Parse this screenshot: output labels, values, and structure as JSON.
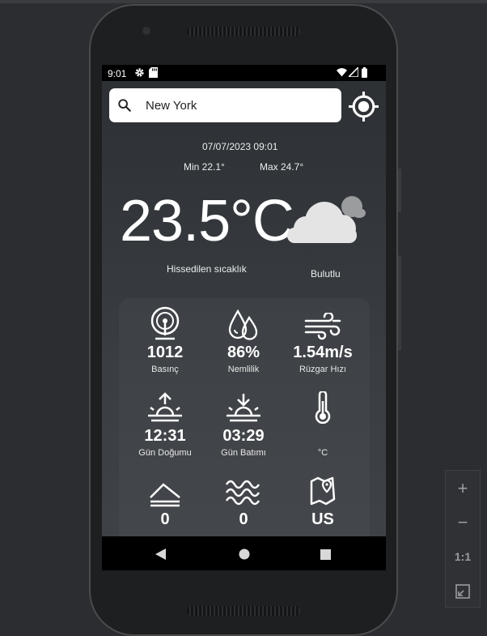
{
  "status": {
    "time": "9:01"
  },
  "search": {
    "value": "New York"
  },
  "weather": {
    "datetime": "07/07/2023 09:01",
    "min": "Min 22.1°",
    "max": "Max 24.7°",
    "temperature": "23.5°C",
    "feels_like_label": "Hissedilen sıcaklık",
    "condition": "Bulutlu"
  },
  "details": [
    {
      "icon": "pressure-gauge-icon",
      "value": "1012",
      "label": "Basınç"
    },
    {
      "icon": "humidity-drops-icon",
      "value": "86%",
      "label": "Nemlilik"
    },
    {
      "icon": "wind-icon",
      "value": "1.54m/s",
      "label": "Rüzgar Hızı"
    },
    {
      "icon": "sunrise-icon",
      "value": "12:31",
      "label": "Gün Doğumu"
    },
    {
      "icon": "sunset-icon",
      "value": "03:29",
      "label": "Gün Batımı"
    },
    {
      "icon": "thermometer-icon",
      "value": "",
      "label": "°C"
    },
    {
      "icon": "mountain-icon",
      "value": "0",
      "label": ""
    },
    {
      "icon": "waves-icon",
      "value": "0",
      "label": ""
    },
    {
      "icon": "map-location-icon",
      "value": "US",
      "label": ""
    }
  ],
  "zoom_controls": {
    "plus": "+",
    "minus": "−",
    "one_to_one": "1:1"
  },
  "colors": {
    "screen_bg": "#2c2f33",
    "card_bg": "#3d4145",
    "text": "#ffffff"
  }
}
